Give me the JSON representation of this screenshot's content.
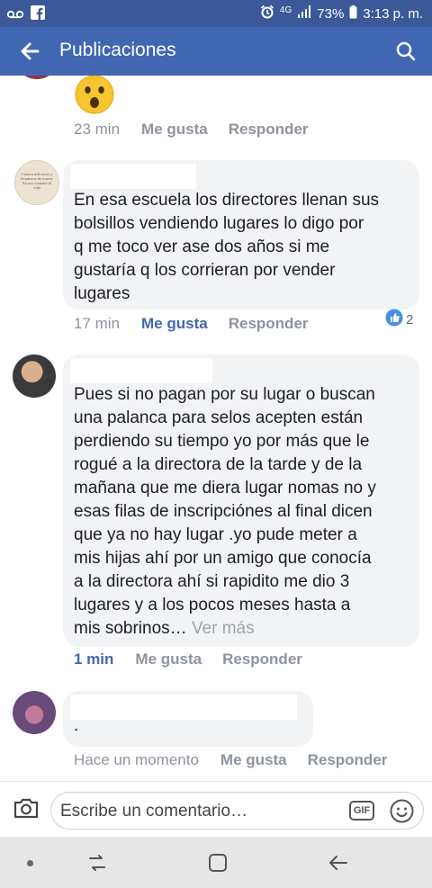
{
  "status_bar": {
    "network": "4G",
    "battery": "73%",
    "time": "3:13 p. m."
  },
  "app_bar": {
    "title": "Publicaciones"
  },
  "comments": [
    {
      "text": "",
      "emoji": "😮",
      "time": "23 min",
      "like": "Me gusta",
      "reply": "Responder",
      "liked": false
    },
    {
      "avatar_text": "Cuenca mil veces y levantarse de nuevo. En eso consiste la vida",
      "lines": [
        "En esa escuela los directores llenan sus",
        "bolsillos vendiendo lugares lo digo por",
        "q me toco ver ase dos años si me",
        "gustaría q los corrieran por vender",
        "lugares"
      ],
      "time": "17 min",
      "like": "Me gusta",
      "reply": "Responder",
      "liked": true,
      "reaction_count": "2"
    },
    {
      "lines": [
        "Pues si no pagan por su lugar o buscan",
        "una palanca para selos acepten están",
        "perdiendo su tiempo yo por más que le",
        "rogué a la directora de la tarde y de la",
        "mañana que me diera lugar nomas no y",
        "esas filas de inscripciónes al final dicen",
        "que ya no hay lugar .yo pude meter a",
        "mis hijas ahí por un amigo que conocía",
        "a la directora ahí si rapidito me dio 3",
        "lugares y a los pocos meses hasta a",
        "mis sobrinos…"
      ],
      "see_more": "Ver más",
      "time": "1 min",
      "like": "Me gusta",
      "reply": "Responder",
      "time_highlight": true
    },
    {
      "text": ".",
      "time": "Hace un momento",
      "like": "Me gusta",
      "reply": "Responder"
    }
  ],
  "composer": {
    "placeholder": "Escribe un comentario…",
    "gif_label": "GIF"
  },
  "colors": {
    "status_bar": "#3b5998",
    "app_bar": "#4267b2",
    "link": "#4267b2",
    "bubble": "#f2f3f5",
    "meta": "#8d949e"
  }
}
